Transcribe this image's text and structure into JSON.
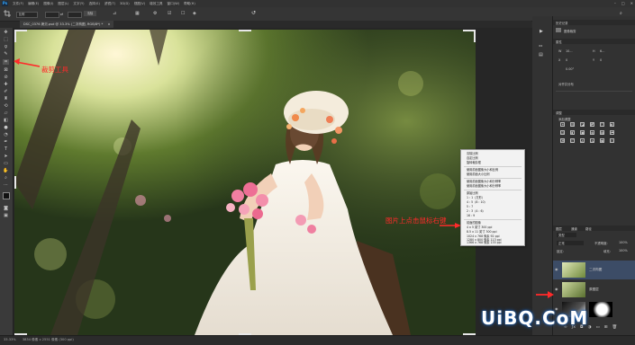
{
  "app": {
    "logo": "Ps"
  },
  "menu": {
    "items": [
      "文件(F)",
      "编辑(E)",
      "图像(I)",
      "图层(L)",
      "文字(Y)",
      "选择(S)",
      "滤镜(T)",
      "3D(D)",
      "视图(V)",
      "增效工具",
      "窗口(W)",
      "帮助(H)"
    ],
    "window_controls": [
      "–",
      "□",
      "✕"
    ]
  },
  "options": {
    "ratio_label": "比例",
    "clear_label": "清除"
  },
  "document_tab": {
    "title": "DSC_0376 拷贝.psd @ 33.3% (二次构图, RGB/8*) *",
    "close": "×"
  },
  "status": {
    "zoom": "33.33%",
    "info": "3834 像素 x 2551 像素 (300 ppi)"
  },
  "annotations": {
    "crop_tool": "裁剪工具",
    "right_click": "图片上点击鼠标右键"
  },
  "context_menu": {
    "items": [
      "清除比例",
      "自定比例",
      "旋转裁剪框",
      "使用前面图像大小和比例",
      "使用前面大小比例",
      "使用前面图像大小和分辨率",
      "使用前面图像大小和分辨率",
      "原始比例",
      "1 : 1（方形）",
      "4 : 5（8 : 10）",
      "5 : 7",
      "2 : 3（4 : 6）",
      "16 : 9",
      "前面的图像",
      "4 x 5 英寸 300 ppi",
      "8.5 x 11 英寸 300 ppi",
      "1024 x 768 像素 92 ppi",
      "1280 x 800 像素 113 ppi",
      "1366 x 768 像素 135 ppi"
    ]
  },
  "right_panel": {
    "history_label": "历史记录",
    "history_item": "图像裁剪",
    "props_label": "属性",
    "w_label": "W",
    "h_label": "H",
    "x_label": "X",
    "y_label": "Y",
    "w_value": "10...",
    "h_value": "6...",
    "x_value": "0",
    "y_value": "0",
    "angle_value": "0.00°",
    "align_label": "对齐并分布",
    "adjust_label": "调整",
    "add_adjust_label": "添加调整",
    "layers_label": "图层",
    "channels_label": "通道",
    "paths_label": "路径",
    "kind_label": "类型",
    "blend_mode": "正常",
    "opacity_label": "不透明度:",
    "opacity_value": "100%",
    "lock_label": "锁定:",
    "fill_label": "填充:",
    "fill_value": "100%",
    "layers": [
      {
        "name": "二次构图"
      },
      {
        "name": "原图层"
      },
      {
        "name": ""
      }
    ]
  },
  "watermark": {
    "text": "UiBQ.CoM"
  },
  "colors": {
    "accent": "#31a8ff",
    "annotation": "#ff2a2a",
    "selected_layer": "#3c4c66"
  }
}
